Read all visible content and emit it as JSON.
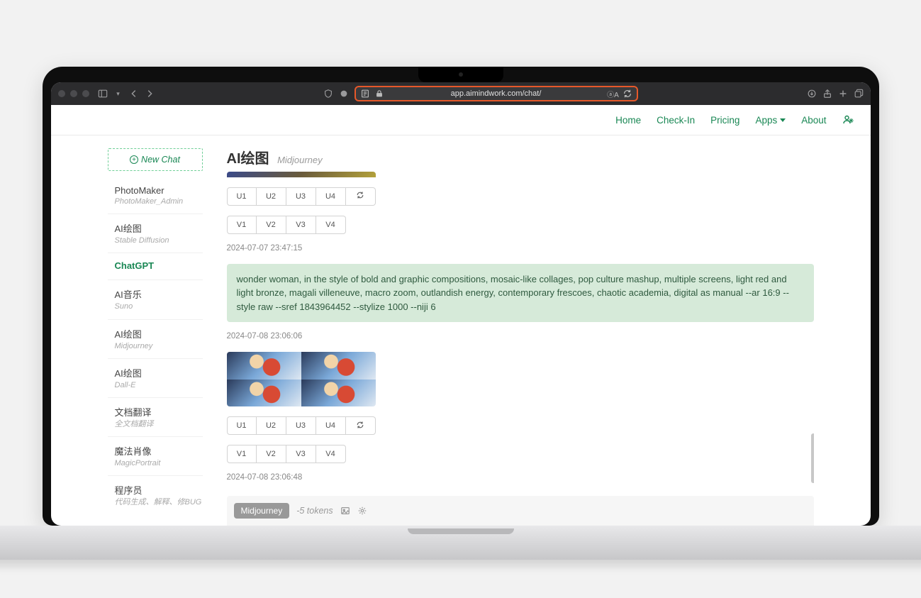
{
  "browser": {
    "url": "app.aimindwork.com/chat/"
  },
  "nav": {
    "home": "Home",
    "checkin": "Check-In",
    "pricing": "Pricing",
    "apps": "Apps",
    "about": "About"
  },
  "sidebar": {
    "new_chat": "New Chat",
    "items": [
      {
        "title": "PhotoMaker",
        "sub": "PhotoMaker_Admin",
        "active": false
      },
      {
        "title": "AI绘图",
        "sub": "Stable Diffusion",
        "active": false
      },
      {
        "title": "ChatGPT",
        "sub": "",
        "active": true
      },
      {
        "title": "AI音乐",
        "sub": "Suno",
        "active": false
      },
      {
        "title": "AI绘图",
        "sub": "Midjourney",
        "active": false
      },
      {
        "title": "AI绘图",
        "sub": "Dall-E",
        "active": false
      },
      {
        "title": "文档翻译",
        "sub": "全文档翻译",
        "active": false
      },
      {
        "title": "魔法肖像",
        "sub": "MagicPortrait",
        "active": false
      },
      {
        "title": "程序员",
        "sub": "代码生成、解释、修BUG",
        "active": false
      }
    ]
  },
  "main": {
    "title": "AI绘图",
    "subtitle": "Midjourney",
    "buttons": {
      "u1": "U1",
      "u2": "U2",
      "u3": "U3",
      "u4": "U4",
      "v1": "V1",
      "v2": "V2",
      "v3": "V3",
      "v4": "V4"
    },
    "ts1": "2024-07-07 23:47:15",
    "prompt": "wonder woman, in the style of bold and graphic compositions, mosaic-like collages, pop culture mashup, multiple screens, light red and light bronze, magali villeneuve, macro zoom, outlandish energy, contemporary frescoes, chaotic academia, digital as manual --ar 16:9 --style raw --sref 1843964452 --stylize 1000 --niji 6",
    "ts2": "2024-07-08 23:06:06",
    "ts3": "2024-07-08 23:06:48",
    "footer": {
      "badge": "Midjourney",
      "tokens": "-5 tokens"
    }
  }
}
